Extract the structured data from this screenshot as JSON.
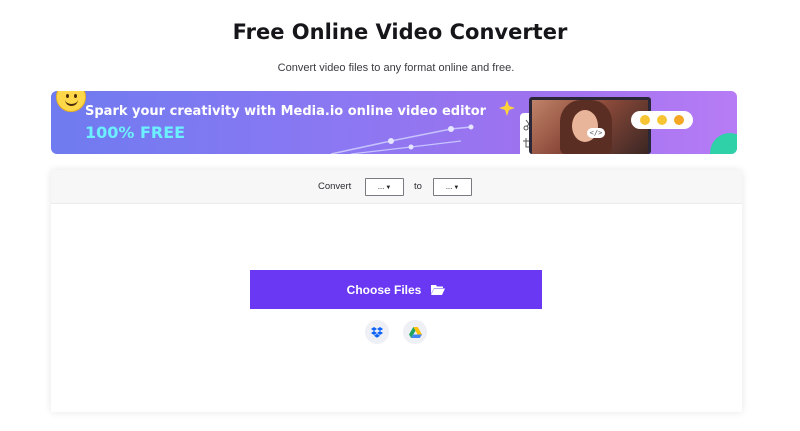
{
  "header": {
    "title": "Free Online Video Converter",
    "subtitle": "Convert video files to any format online and free."
  },
  "banner": {
    "line1": "Spark your creativity with Media.io online video editor",
    "line2": "100% FREE",
    "accent_color": "#6cf0ff",
    "icons": [
      "smiley-face-icon",
      "sparkle-star-icon",
      "scissors-icon",
      "crop-icon",
      "code-icon",
      "emoji-reactions-icon"
    ]
  },
  "converter": {
    "convert_label": "Convert",
    "to_label": "to",
    "from_format": "...",
    "to_format": "...",
    "choose_files_label": "Choose Files",
    "button_color": "#6a38f3",
    "icons": [
      "folder-open-icon",
      "dropbox-icon",
      "google-drive-icon"
    ]
  }
}
